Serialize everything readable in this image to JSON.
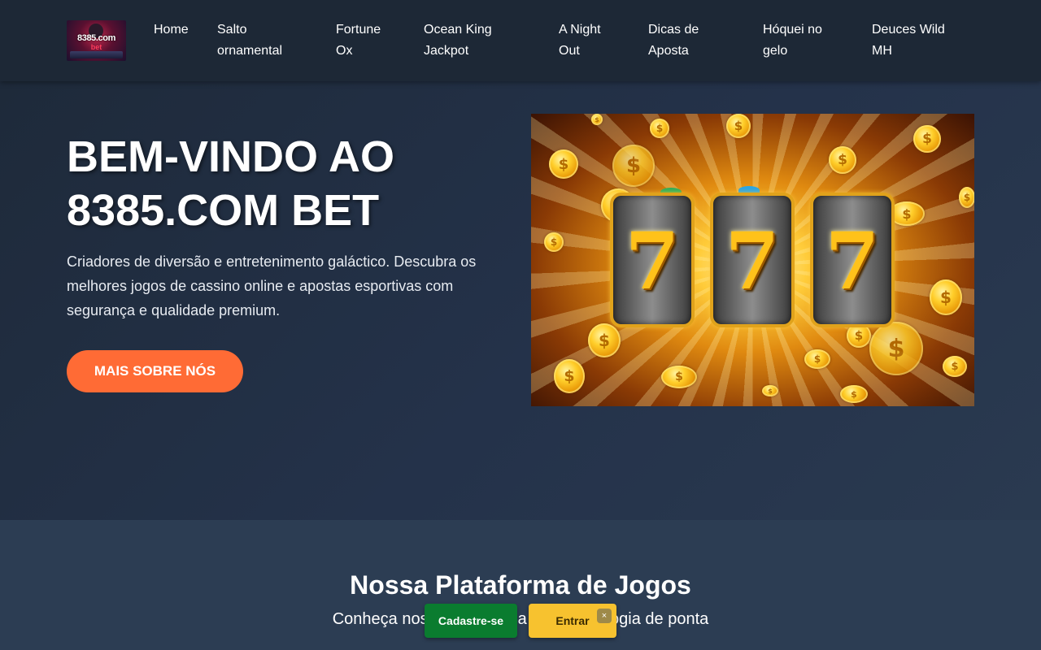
{
  "header": {
    "logo": {
      "main": "8385.com",
      "sub": "bet"
    },
    "nav": [
      {
        "line1": "Home",
        "line2": ""
      },
      {
        "line1": "Salto",
        "line2": "ornamental"
      },
      {
        "line1": "Fortune",
        "line2": "Ox"
      },
      {
        "line1": "Ocean King",
        "line2": "Jackpot"
      },
      {
        "line1": "A Night",
        "line2": "Out"
      },
      {
        "line1": "Dicas de",
        "line2": "Aposta"
      },
      {
        "line1": "Hóquei no",
        "line2": "gelo"
      },
      {
        "line1": "Deuces Wild",
        "line2": "MH"
      }
    ]
  },
  "hero": {
    "title_line1": "BEM-VINDO AO",
    "title_line2": "8385.COM BET",
    "description": "Criadores de diversão e entretenimento galáctico. Descubra os melhores jogos de cassino online e apostas esportivas com segurança e qualidade premium.",
    "cta_label": "MAIS SOBRE NÓS",
    "slot_symbols": [
      "7",
      "7",
      "7"
    ],
    "coin_symbol": "$"
  },
  "platform": {
    "title": "Nossa Plataforma de Jogos",
    "subtitle": "Conheça nossa plataforma com tecnologia de ponta"
  },
  "auth_bar": {
    "signup_label": "Cadastre-se",
    "login_label": "Entrar",
    "close_label": "×"
  },
  "colors": {
    "header_bg": "#1d2836",
    "hero_bg": "#24324a",
    "cta": "#ff6b35",
    "signup": "#0a7c2f",
    "login": "#f7c22f"
  }
}
